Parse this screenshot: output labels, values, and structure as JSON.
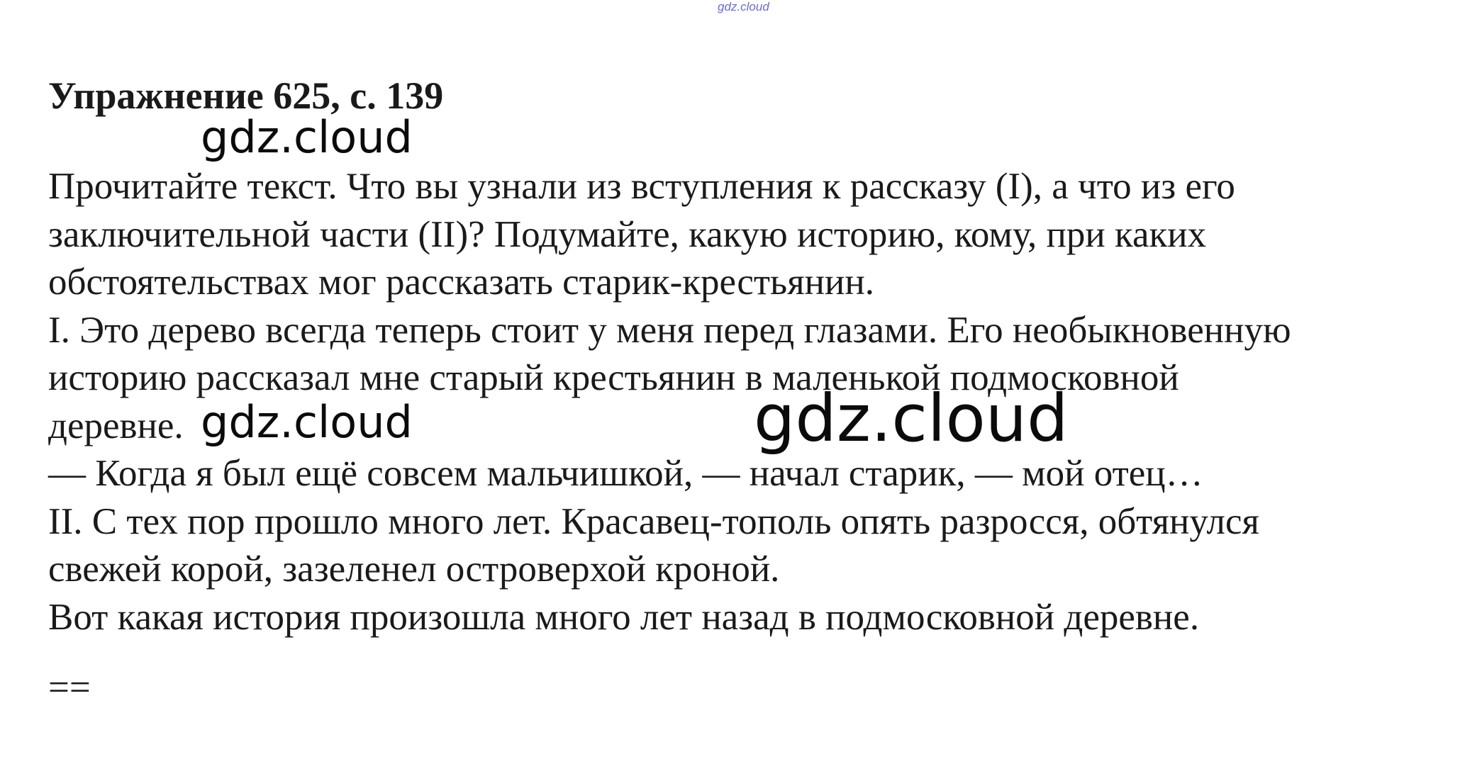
{
  "top_mark": "gdz.cloud",
  "heading": "Упражнение 625, с. 139",
  "lines": [
    "Прочитайте текст. Что вы узнали из вступления к рассказу (I), а что из его",
    "заключительной части (II)? Подумайте, какую историю, кому, при каких",
    "обстоятельствах мог рассказать старик-крестьянин.",
    "I. Это дерево всегда теперь стоит у меня перед глазами. Его необыкновенную",
    "историю рассказал мне старый крестьянин в маленькой подмосковной",
    "деревне.",
    "— Когда я был ещё совсем мальчишкой, — начал старик, — мой отец…",
    "II. С тех пор прошло много лет. Красавец-тополь опять разросся, обтянулся",
    "свежей корой, зазеленел островерхой кроной.",
    "Вот какая история произошла много лет назад в подмосковной деревне."
  ],
  "watermarks": [
    "gdz.cloud",
    "gdz.cloud",
    "gdz.cloud"
  ],
  "end_mark": "=="
}
